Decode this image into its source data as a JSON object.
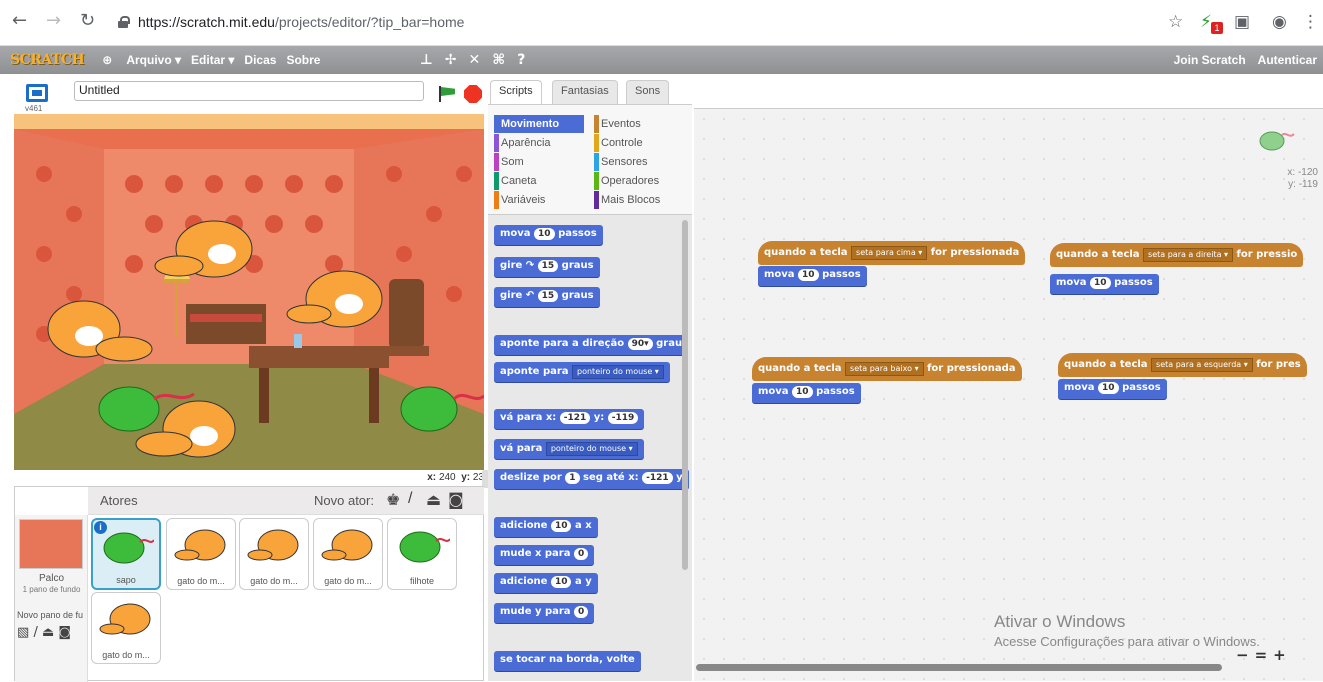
{
  "browser": {
    "url_host": "https://scratch.mit.edu",
    "url_path": "/projects/editor/?tip_bar=home",
    "badge": "1"
  },
  "topbar": {
    "logo": "SCRATCH",
    "menus": [
      "Arquivo ▾",
      "Editar ▾",
      "Dicas",
      "Sobre"
    ],
    "join": "Join Scratch",
    "signin": "Autenticar"
  },
  "stage": {
    "project_title": "Untitled",
    "version": "v461",
    "coords_x_label": "x:",
    "coords_x": "240",
    "coords_y_label": "y:",
    "coords_y": "23"
  },
  "sprites": {
    "header": "Atores",
    "new_sprite": "Novo ator:",
    "stage_label": "Palco",
    "stage_sub": "1 pano de fundo",
    "new_backdrop": "Novo pano de fu",
    "items": [
      "sapo",
      "gato do m...",
      "gato do m...",
      "gato do m...",
      "filhote",
      "gato do m..."
    ]
  },
  "tabs": [
    "Scripts",
    "Fantasias",
    "Sons"
  ],
  "categories": [
    {
      "label": "Movimento",
      "color": "#4a6cd4"
    },
    {
      "label": "Eventos",
      "color": "#c88330"
    },
    {
      "label": "Aparência",
      "color": "#8a55d7"
    },
    {
      "label": "Controle",
      "color": "#e1a91a"
    },
    {
      "label": "Som",
      "color": "#bb42c3"
    },
    {
      "label": "Sensores",
      "color": "#2ca5e2"
    },
    {
      "label": "Caneta",
      "color": "#0e9a6c"
    },
    {
      "label": "Operadores",
      "color": "#5cb712"
    },
    {
      "label": "Variáveis",
      "color": "#ee7d16"
    },
    {
      "label": "Mais Blocos",
      "color": "#632d99"
    }
  ],
  "palette": {
    "move": [
      "mova",
      "10",
      "passos"
    ],
    "turn_right": [
      "gire ↷",
      "15",
      "graus"
    ],
    "turn_left": [
      "gire ↶",
      "15",
      "graus"
    ],
    "point_dir": [
      "aponte para a direção",
      "90▾",
      "grau"
    ],
    "point_to": [
      "aponte para",
      "ponteiro do mouse ▾"
    ],
    "goto_xy": [
      "vá para x:",
      "-121",
      "y:",
      "-119"
    ],
    "goto": [
      "vá para",
      "ponteiro do mouse ▾"
    ],
    "glide": [
      "deslize por",
      "1",
      "seg até x:",
      "-121",
      "y"
    ],
    "change_x": [
      "adicione",
      "10",
      "a x"
    ],
    "set_x": [
      "mude x para",
      "0"
    ],
    "change_y": [
      "adicione",
      "10",
      "a y"
    ],
    "set_y": [
      "mude y para",
      "0"
    ],
    "bounce": "se tocar na borda, volte"
  },
  "scripts": [
    {
      "hat": [
        "quando a tecla",
        "seta para cima ▾",
        "for pressionada"
      ],
      "move": [
        "mova",
        "10",
        "passos"
      ]
    },
    {
      "hat": [
        "quando a tecla",
        "seta para a direita ▾",
        "for pressio"
      ],
      "move": [
        "mova",
        "10",
        "passos"
      ]
    },
    {
      "hat": [
        "quando a tecla",
        "seta para baixo ▾",
        "for pressionada"
      ],
      "move": [
        "mova",
        "10",
        "passos"
      ]
    },
    {
      "hat": [
        "quando a tecla",
        "seta para a esquerda ▾",
        "for pres"
      ],
      "move": [
        "mova",
        "10",
        "passos"
      ]
    }
  ],
  "sprite_info": {
    "x": "x: -120",
    "y": "y: -119"
  },
  "watermark": {
    "line1": "Ativar o Windows",
    "line2": "Acesse Configurações para ativar o Windows."
  },
  "zoom": [
    "−",
    "=",
    "+"
  ]
}
